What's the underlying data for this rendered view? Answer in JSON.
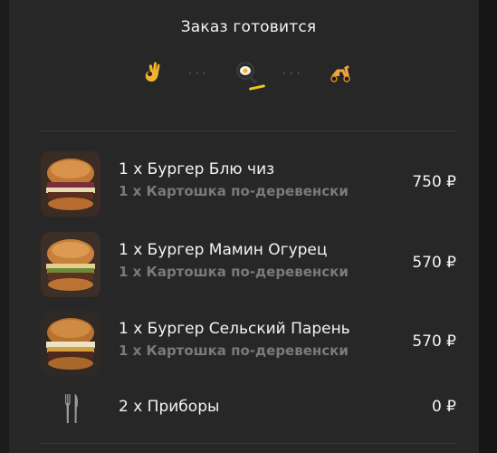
{
  "order": {
    "status_title": "Заказ готовится",
    "steps": [
      {
        "icon": "ok-hand-icon"
      },
      {
        "icon": "frying-pan-icon",
        "active": true
      },
      {
        "icon": "scooter-icon"
      }
    ],
    "step_dots": "···",
    "accent_color": "#f5c218"
  },
  "items": [
    {
      "name": "1 x Бургер Блю чиз",
      "side": "1 x Картошка по-деревенски",
      "price": "750 ₽",
      "image": "burger-photo-icon"
    },
    {
      "name": "1 x Бургер Мамин Огурец",
      "side": "1 x Картошка по-деревенски",
      "price": "570 ₽",
      "image": "burger-photo-icon"
    },
    {
      "name": "1 x Бургер Сельский Парень",
      "side": "1 x Картошка по-деревенски",
      "price": "570 ₽",
      "image": "burger-photo-icon"
    }
  ],
  "cutlery": {
    "name": "2 x Приборы",
    "price": "0 ₽",
    "icon": "fork-knife-icon"
  }
}
